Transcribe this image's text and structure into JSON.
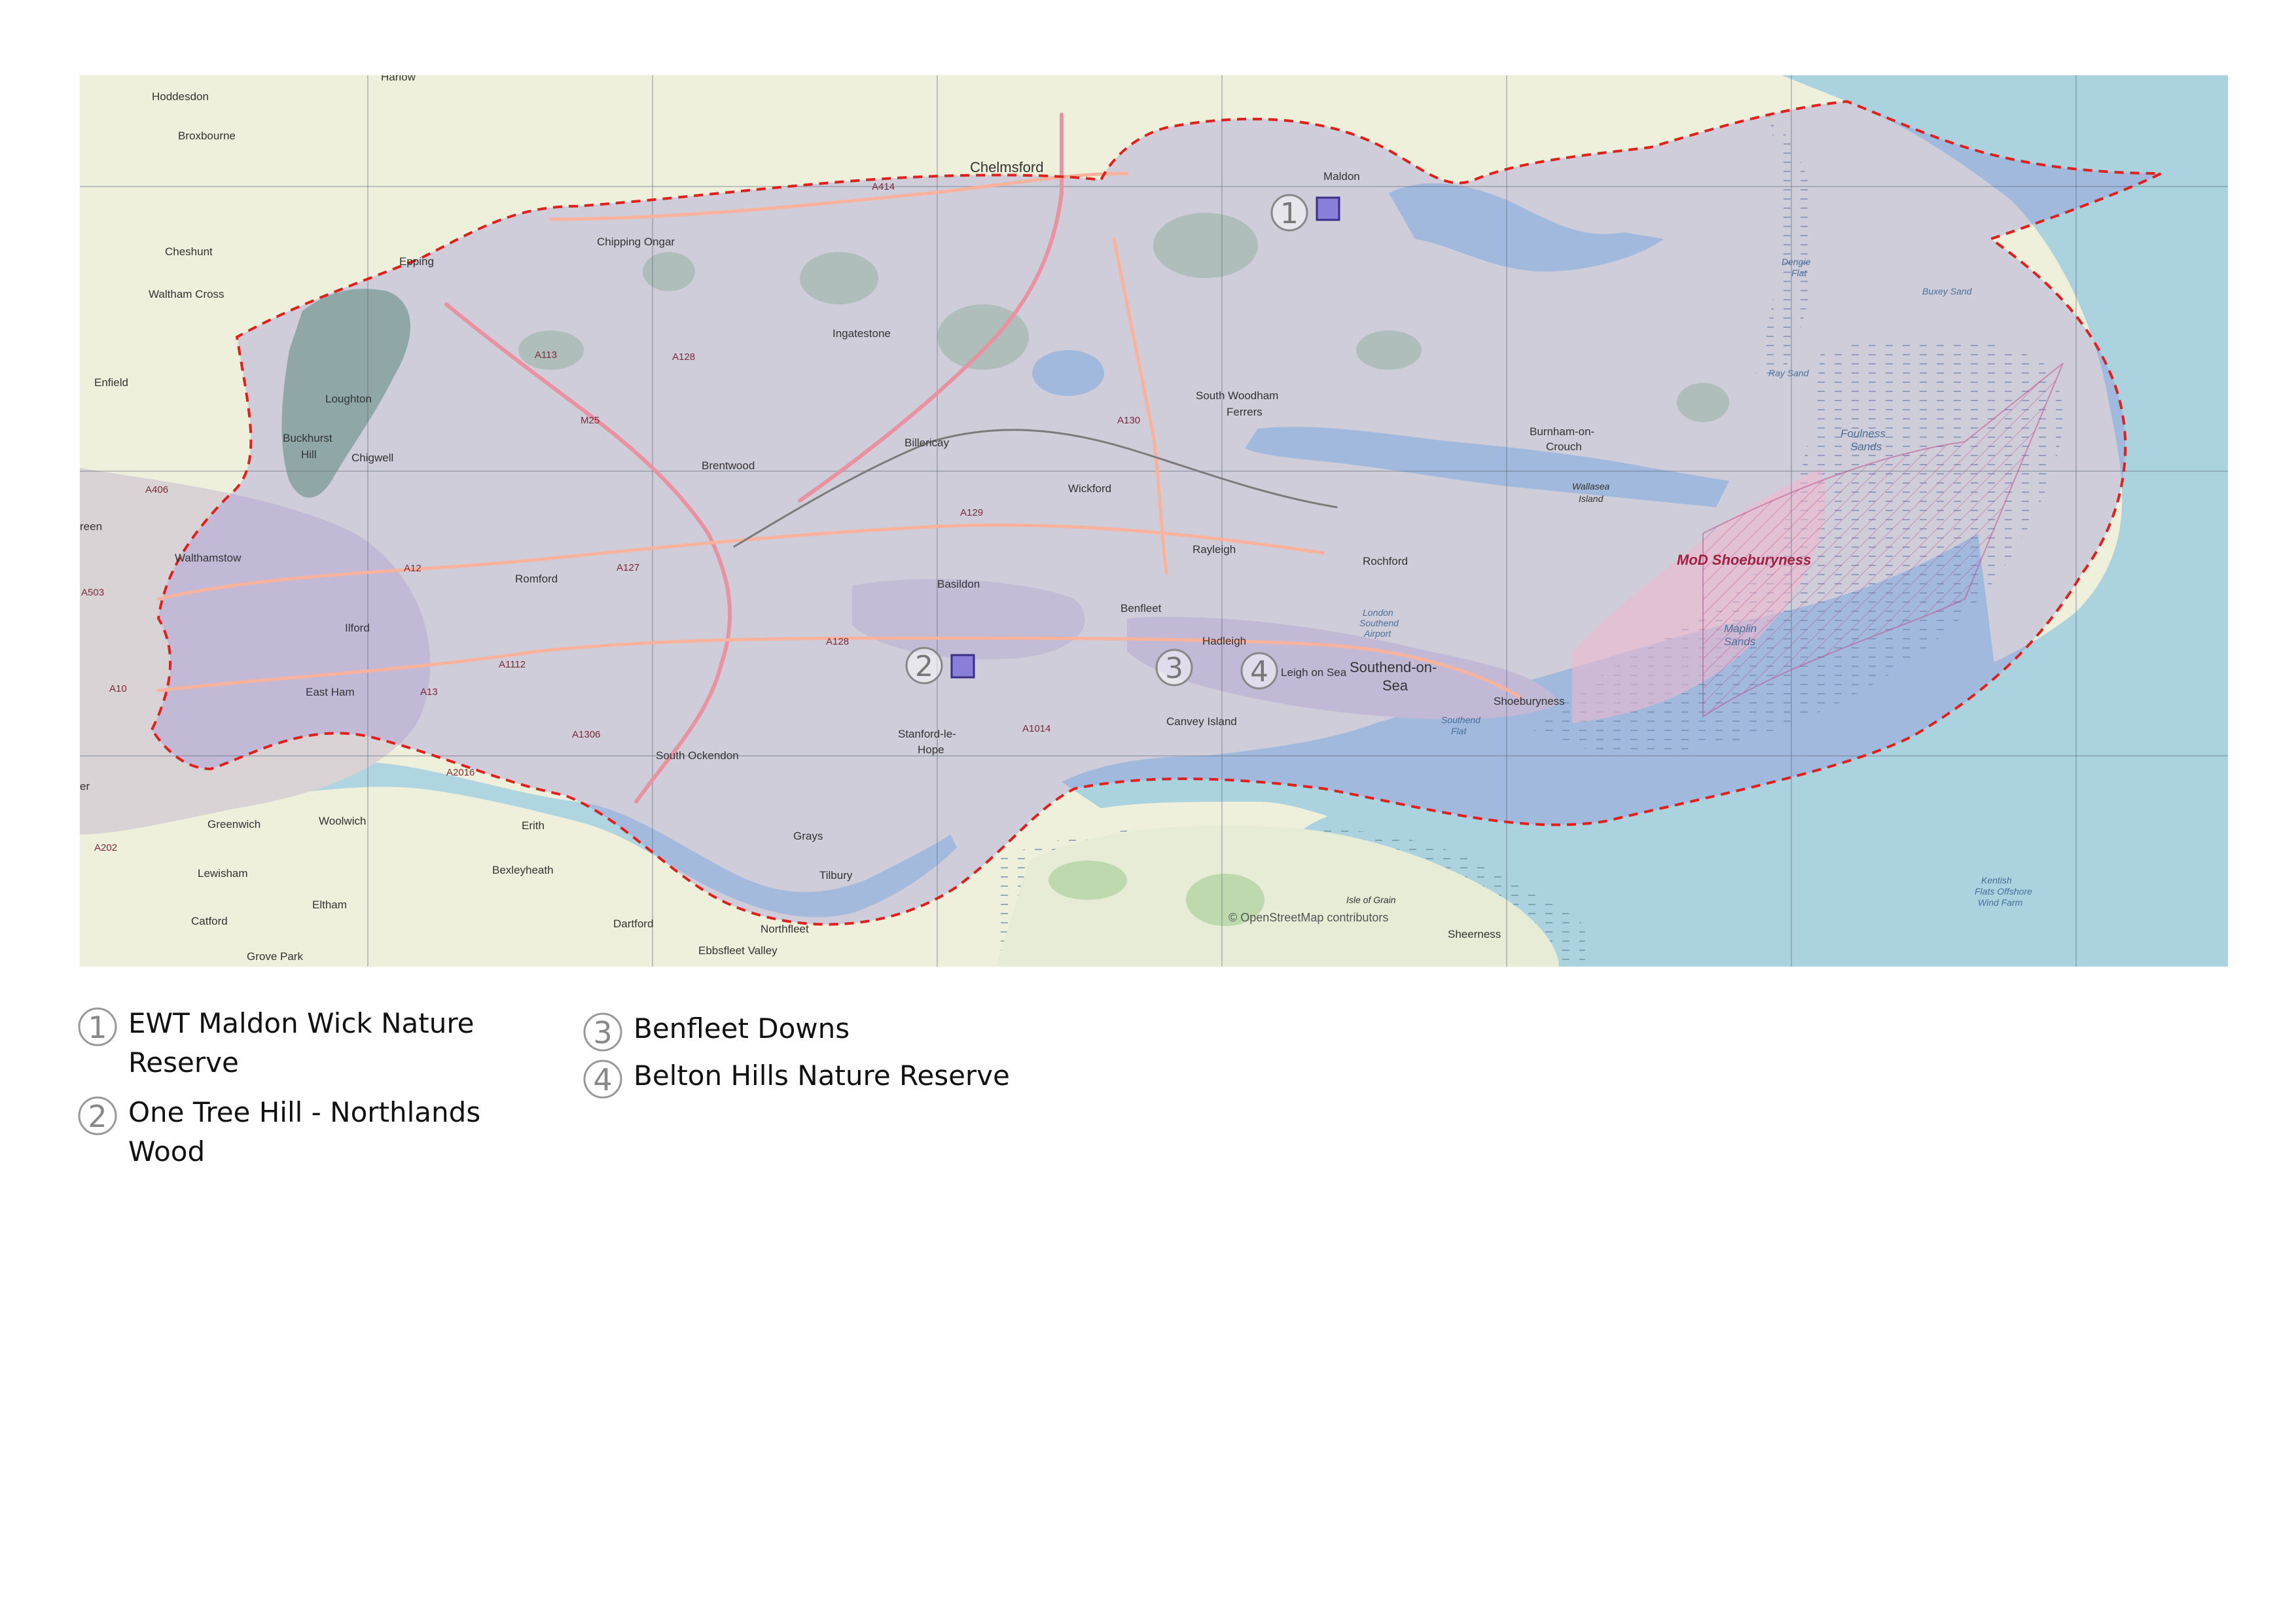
{
  "map": {
    "attribution": "© OpenStreetMap contributors",
    "colors": {
      "land": "#eef0dc",
      "urban": "#dcd6d6",
      "sea": "#aad3df",
      "study_area_fill": "#8e82d6",
      "boundary": "#e0201c",
      "road_major": "#e892a2",
      "road_trunk": "#f9b29c",
      "marker_fill": "#8a7fd8",
      "mod_fill": "#f3b8d0"
    },
    "places": [
      "Harlow",
      "Hoddesdon",
      "Broxbourne",
      "Cheshunt",
      "Waltham Cross",
      "Enfield",
      "Epping",
      "Loughton",
      "Buckhurst",
      "Hill",
      "Chigwell",
      "Chipping Ongar",
      "Chelmsford",
      "Maldon",
      "Ingatestone",
      "South Woodham",
      "Ferrers",
      "Billericay",
      "Brentwood",
      "Wickford",
      "Rayleigh",
      "Rochford",
      "Burnham-on-",
      "Crouch",
      "Wallasea",
      "Island",
      "Walthamstow",
      "Romford",
      "Ilford",
      "East Ham",
      "Basildon",
      "Benfleet",
      "Hadleigh",
      "Southend-on-",
      "Sea",
      "Shoeburyness",
      "Canvey Island",
      "Stanford-le-",
      "Hope",
      "South Ockendon",
      "Grays",
      "Tilbury",
      "Greenwich",
      "Woolwich",
      "Erith",
      "Bexleyheath",
      "Lewisham",
      "Eltham",
      "Catford",
      "Grove Park",
      "Dartford",
      "Northfleet",
      "Ebbsfleet Valley",
      "Isle of Grain",
      "Sheerness",
      "Leigh on Sea",
      "reen",
      "er"
    ],
    "sea_labels": [
      "Dengie",
      "Flat",
      "Buxey Sand",
      "Ray Sand",
      "Foulness",
      "Sands",
      "Maplin",
      "Sands",
      "Southend",
      "Flat",
      "London",
      "Southend",
      "Airport",
      "Kentish",
      "Flats Offshore",
      "Wind Farm"
    ],
    "mod_label": "MoD Shoeburyness",
    "roads": [
      "A414",
      "M25",
      "A113",
      "A128",
      "A130",
      "A129",
      "A12",
      "A127",
      "A406",
      "A503",
      "A10",
      "A13",
      "A1112",
      "A1306",
      "A2016",
      "A202",
      "A1014",
      "A128"
    ],
    "markers": [
      {
        "number": "1"
      },
      {
        "number": "2"
      },
      {
        "number": "3"
      },
      {
        "number": "4"
      }
    ]
  },
  "legend": {
    "items": [
      {
        "number": "1",
        "label_line1": "EWT Maldon Wick Nature",
        "label_line2": "Reserve"
      },
      {
        "number": "2",
        "label_line1": "One Tree Hill - Northlands",
        "label_line2": "Wood"
      },
      {
        "number": "3",
        "label_line1": "Benfleet Downs",
        "label_line2": ""
      },
      {
        "number": "4",
        "label_line1": "Belton Hills Nature Reserve",
        "label_line2": ""
      }
    ]
  }
}
